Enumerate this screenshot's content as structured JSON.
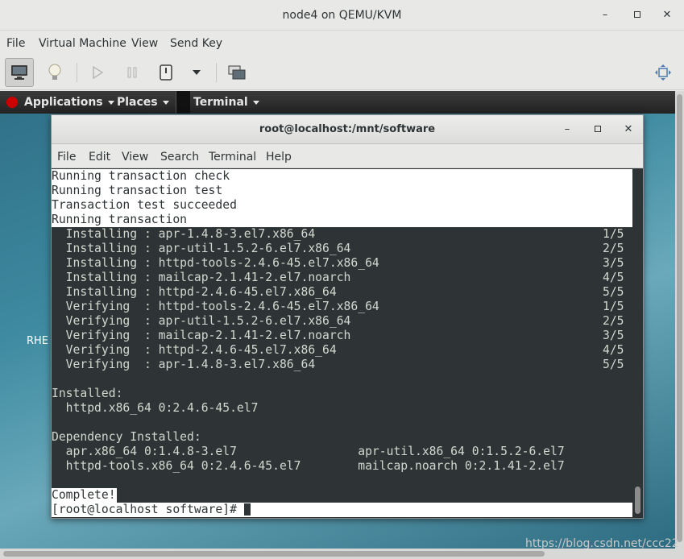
{
  "window": {
    "title": "node4 on QEMU/KVM",
    "menu": [
      "File",
      "Virtual Machine",
      "View",
      "Send Key"
    ]
  },
  "toolbar": {
    "icons": [
      "monitor-icon",
      "lightbulb-icon",
      "play-icon",
      "pause-icon",
      "power-icon",
      "dropdown-icon",
      "snapshots-icon",
      "fullscreen-icon"
    ]
  },
  "guest": {
    "topbar": {
      "applications": "Applications",
      "places": "Places",
      "terminal": "Terminal"
    },
    "desktop_label": "RHE"
  },
  "terminal": {
    "title": "root@localhost:/mnt/software",
    "menu": [
      "File",
      "Edit",
      "View",
      "Search",
      "Terminal",
      "Help"
    ],
    "lines": [
      {
        "left": "Running transaction check",
        "right": "",
        "hl": true
      },
      {
        "left": "Running transaction test",
        "right": "",
        "hl": true
      },
      {
        "left": "Transaction test succeeded",
        "right": "",
        "hl": true
      },
      {
        "left": "Running transaction",
        "right": "",
        "hl": true
      },
      {
        "left": "  Installing : apr-1.4.8-3.el7.x86_64",
        "right": "1/5",
        "hl": false
      },
      {
        "left": "  Installing : apr-util-1.5.2-6.el7.x86_64",
        "right": "2/5",
        "hl": false
      },
      {
        "left": "  Installing : httpd-tools-2.4.6-45.el7.x86_64",
        "right": "3/5",
        "hl": false
      },
      {
        "left": "  Installing : mailcap-2.1.41-2.el7.noarch",
        "right": "4/5",
        "hl": false
      },
      {
        "left": "  Installing : httpd-2.4.6-45.el7.x86_64",
        "right": "5/5",
        "hl": false
      },
      {
        "left": "  Verifying  : httpd-tools-2.4.6-45.el7.x86_64",
        "right": "1/5",
        "hl": false
      },
      {
        "left": "  Verifying  : apr-util-1.5.2-6.el7.x86_64",
        "right": "2/5",
        "hl": false
      },
      {
        "left": "  Verifying  : mailcap-2.1.41-2.el7.noarch",
        "right": "3/5",
        "hl": false
      },
      {
        "left": "  Verifying  : httpd-2.4.6-45.el7.x86_64",
        "right": "4/5",
        "hl": false
      },
      {
        "left": "  Verifying  : apr-1.4.8-3.el7.x86_64",
        "right": "5/5",
        "hl": false
      },
      {
        "left": "",
        "right": "",
        "hl": false
      },
      {
        "left": "Installed:",
        "right": "",
        "hl": false
      },
      {
        "left": "  httpd.x86_64 0:2.4.6-45.el7",
        "right": "",
        "hl": false
      },
      {
        "left": "",
        "right": "",
        "hl": false
      },
      {
        "left": "Dependency Installed:",
        "right": "",
        "hl": false
      },
      {
        "left": "  apr.x86_64 0:1.4.8-3.el7                 apr-util.x86_64 0:1.5.2-6.el7",
        "right": "",
        "hl": false
      },
      {
        "left": "  httpd-tools.x86_64 0:2.4.6-45.el7        mailcap.noarch 0:2.1.41-2.el7",
        "right": "",
        "hl": false
      },
      {
        "left": "",
        "right": "",
        "hl": false
      },
      {
        "left": "Complete!",
        "right": "",
        "hl": true
      }
    ],
    "prompt": "[root@localhost software]# "
  },
  "watermark": "https://blog.csdn.net/ccc22",
  "colors": {
    "terminal_bg": "#2e3436",
    "terminal_fg": "#d3d7cf",
    "selection_bg": "#ffffff",
    "desktop": "#3e8aa0"
  }
}
